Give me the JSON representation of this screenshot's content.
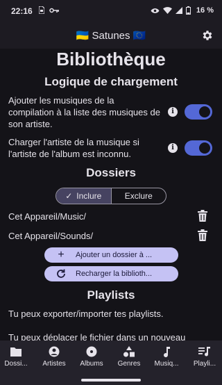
{
  "status_bar": {
    "time": "22:16",
    "battery": "16 %",
    "left_icons": [
      "sim-card-icon",
      "key-icon"
    ],
    "right_icons": [
      "eye-icon",
      "wifi-icon",
      "signal-icon",
      "battery-icon"
    ]
  },
  "app_bar": {
    "title": "🇺🇦 Satunes 🇪🇺",
    "settings_icon": "gear-icon"
  },
  "page": {
    "title": "Bibliothèque",
    "loading_section": {
      "title": "Logique de chargement",
      "options": [
        {
          "label": "Ajouter les musiques de la compilation à la liste des musiques de son artiste.",
          "enabled": true
        },
        {
          "label": "Charger l'artiste de la musique si l'artiste de l'album est inconnu.",
          "enabled": true
        }
      ]
    },
    "folders_section": {
      "title": "Dossiers",
      "segments": [
        "Inclure",
        "Exclure"
      ],
      "selected_segment": "Inclure",
      "folders": [
        "Cet Appareil/Music/",
        "Cet Appareil/Sounds/"
      ],
      "add_button": "Ajouter un dossier à ...",
      "reload_button": "Recharger la biblioth..."
    },
    "playlists_section": {
      "title": "Playlists",
      "line1": "Tu peux exporter/importer tes playlists.",
      "line2": "Tu peux déplacer le fichier dans un nouveau"
    }
  },
  "bottom_nav": [
    {
      "label": "Dossi...",
      "icon": "folder-icon"
    },
    {
      "label": "Artistes",
      "icon": "account-icon"
    },
    {
      "label": "Albums",
      "icon": "album-icon"
    },
    {
      "label": "Genres",
      "icon": "category-icon"
    },
    {
      "label": "Musiq...",
      "icon": "music-note-icon"
    },
    {
      "label": "Playli...",
      "icon": "playlist-icon"
    }
  ],
  "colors": {
    "accent": "#5468d6",
    "button_bg": "#c5c2f4",
    "surface": "#141318",
    "bar": "#1d1b22"
  }
}
